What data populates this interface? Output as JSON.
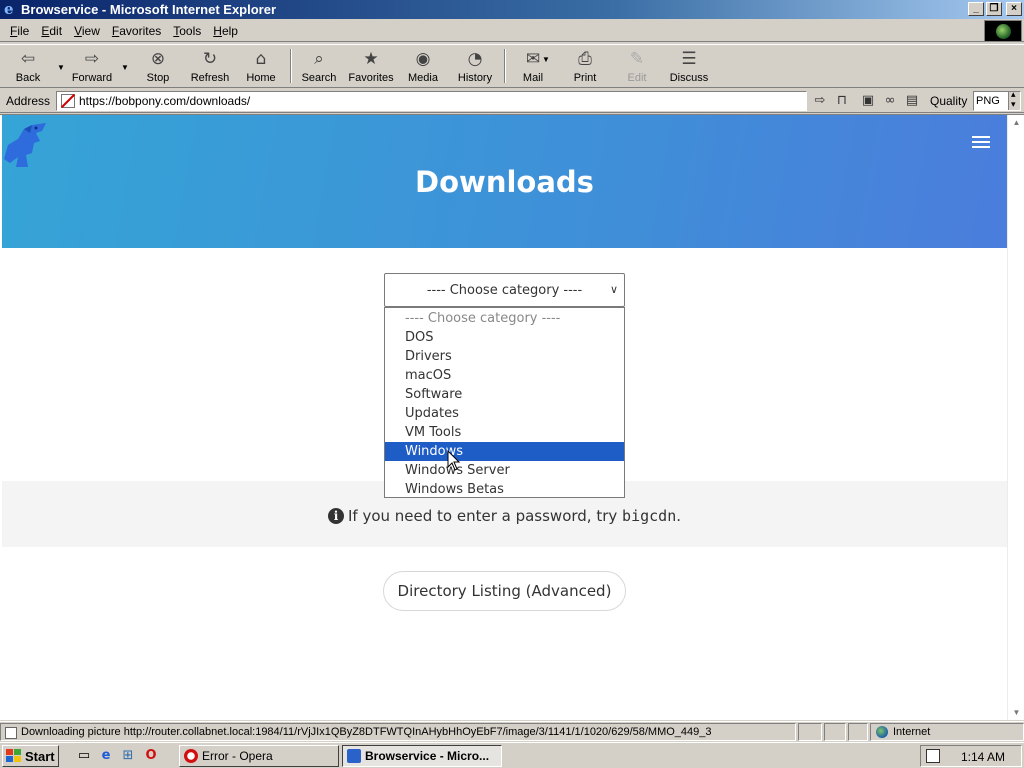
{
  "window": {
    "title": "Browservice - Microsoft Internet Explorer",
    "controls": [
      "minimize",
      "maximize",
      "close"
    ]
  },
  "menubar": {
    "items": [
      {
        "key": "F",
        "rest": "ile"
      },
      {
        "key": "E",
        "rest": "dit"
      },
      {
        "key": "V",
        "rest": "iew"
      },
      {
        "key": "F",
        "rest": "avorites",
        "pre": ""
      },
      {
        "key": "T",
        "rest": "ools"
      },
      {
        "key": "H",
        "rest": "elp"
      }
    ]
  },
  "toolbar": {
    "back": "Back",
    "forward": "Forward",
    "stop": "Stop",
    "refresh": "Refresh",
    "home": "Home",
    "search": "Search",
    "favorites": "Favorites",
    "media": "Media",
    "history": "History",
    "mail": "Mail",
    "print": "Print",
    "edit": "Edit",
    "discuss": "Discuss"
  },
  "address": {
    "label": "Address",
    "url": "https://bobpony.com/downloads/",
    "quality_label": "Quality",
    "quality_value": "PNG"
  },
  "page": {
    "title": "Downloads",
    "category_select": {
      "selected": "---- Choose category ----",
      "options": [
        "---- Choose category ----",
        "DOS",
        "Drivers",
        "macOS",
        "Software",
        "Updates",
        "VM Tools",
        "Windows",
        "Windows Server",
        "Windows Betas"
      ],
      "highlighted": "Windows"
    },
    "password_notice": {
      "text": "If you need to enter a password, try ",
      "code": "bigcdn",
      "end": "."
    },
    "directory_button": "Directory Listing (Advanced)"
  },
  "status": {
    "text": "Downloading picture http://router.collabnet.local:1984/11/rVjJIx1QByZ8DTFWTQInAHybHhOyEbF7/image/3/1141/1/1020/629/58/MMO_449_3",
    "zone": "Internet"
  },
  "taskbar": {
    "start": "Start",
    "tasks": [
      "Error - Opera",
      "Browservice - Micro..."
    ],
    "clock": "1:14 AM"
  },
  "colors": {
    "titlebar_start": "#0a246a",
    "hero_blue": "#3f8fd8",
    "selection_blue": "#1e5dc6",
    "chrome_gray": "#d4d0c8"
  }
}
